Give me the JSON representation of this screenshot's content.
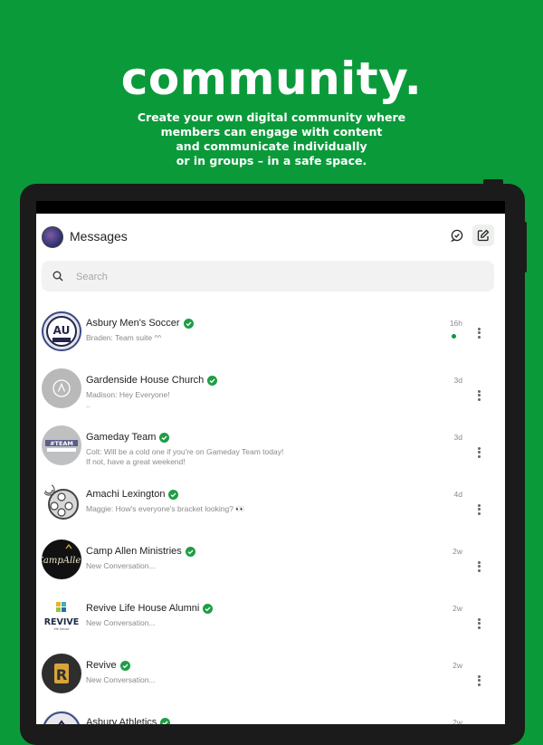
{
  "hero": {
    "title": "community.",
    "subtitle_lines": [
      "Create your own digital community where",
      "members can engage with content",
      "and communicate individually",
      "or in groups – in a safe space."
    ]
  },
  "header": {
    "title": "Messages",
    "chat_icon": "chat-check-icon",
    "compose_icon": "compose-icon"
  },
  "search": {
    "placeholder": "Search"
  },
  "colors": {
    "brand": "#0b9a3a",
    "verified": "#1e9e45"
  },
  "conversations": [
    {
      "name": "Asbury Men's Soccer",
      "message": "Braden: Team suite ^^",
      "message2": "",
      "time": "16h",
      "unread": true,
      "avatar_text": "AU"
    },
    {
      "name": "Gardenside House Church",
      "message": "Madison: Hey Everyone!",
      "message2": "..",
      "time": "3d",
      "unread": false,
      "avatar_text": ""
    },
    {
      "name": "Gameday Team",
      "message": "Colt: Will be a cold one if you're on Gameday Team today!",
      "message2": "If not, have a great weekend!",
      "time": "3d",
      "unread": false,
      "avatar_text": "#TEAM"
    },
    {
      "name": "Amachi Lexington",
      "message": "Maggie: How's everyone's bracket looking? 👀",
      "message2": "",
      "time": "4d",
      "unread": false,
      "avatar_text": ""
    },
    {
      "name": "Camp Allen Ministries",
      "message": "New Conversation...",
      "message2": "",
      "time": "2w",
      "unread": false,
      "avatar_text": "CampAllen"
    },
    {
      "name": "Revive Life House Alumni",
      "message": "New Conversation...",
      "message2": "",
      "time": "2w",
      "unread": false,
      "avatar_text": "REVIVE"
    },
    {
      "name": "Revive",
      "message": "New Conversation...",
      "message2": "",
      "time": "2w",
      "unread": false,
      "avatar_text": "R"
    },
    {
      "name": "Asbury Athletics",
      "message": "",
      "message2": "",
      "time": "2w",
      "unread": false,
      "avatar_text": ""
    }
  ]
}
